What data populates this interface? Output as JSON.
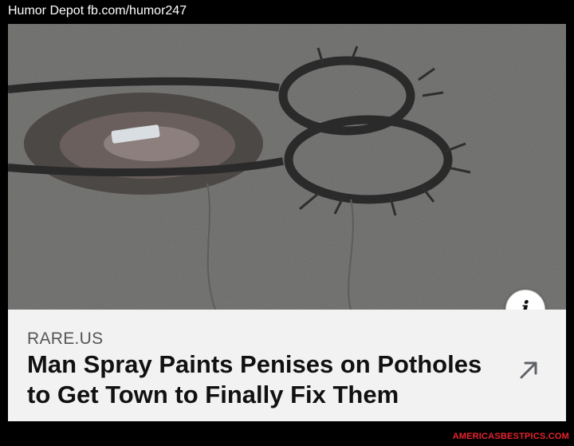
{
  "header": {
    "text": "Humor Depot fb.com/humor247"
  },
  "card": {
    "source": "RARE.US",
    "headline": "Man Spray Paints Penises on Potholes to Get Town to Finally Fix Them",
    "info_icon": "info-icon",
    "arrow_icon": "external-arrow-icon"
  },
  "watermark": "AMERICASBESTPICS.COM",
  "colors": {
    "background": "#000000",
    "caption_bg": "#f2f2f2",
    "watermark": "#e8232f"
  }
}
